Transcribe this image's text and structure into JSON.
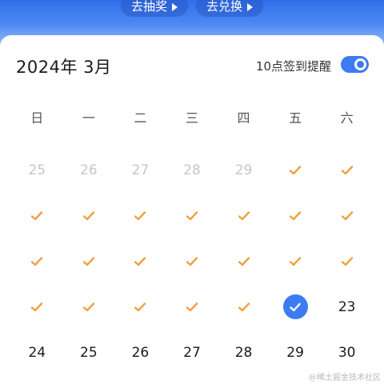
{
  "header": {
    "lottery_label": "去抽奖",
    "redeem_label": "去兑换"
  },
  "calendar": {
    "month_title": "2024年 3月",
    "reminder_label": "10点签到提醒",
    "reminder_enabled": true,
    "weekdays": [
      "日",
      "一",
      "二",
      "三",
      "四",
      "五",
      "六"
    ],
    "cells": [
      {
        "text": "25",
        "state": "other-month"
      },
      {
        "text": "26",
        "state": "other-month"
      },
      {
        "text": "27",
        "state": "other-month"
      },
      {
        "text": "28",
        "state": "other-month"
      },
      {
        "text": "29",
        "state": "other-month"
      },
      {
        "text": "",
        "state": "signed"
      },
      {
        "text": "",
        "state": "signed"
      },
      {
        "text": "",
        "state": "signed"
      },
      {
        "text": "",
        "state": "signed"
      },
      {
        "text": "",
        "state": "signed"
      },
      {
        "text": "",
        "state": "signed"
      },
      {
        "text": "",
        "state": "signed"
      },
      {
        "text": "",
        "state": "signed"
      },
      {
        "text": "",
        "state": "signed"
      },
      {
        "text": "",
        "state": "signed"
      },
      {
        "text": "",
        "state": "signed"
      },
      {
        "text": "",
        "state": "signed"
      },
      {
        "text": "",
        "state": "signed"
      },
      {
        "text": "",
        "state": "signed"
      },
      {
        "text": "",
        "state": "signed"
      },
      {
        "text": "",
        "state": "signed"
      },
      {
        "text": "",
        "state": "signed"
      },
      {
        "text": "",
        "state": "signed"
      },
      {
        "text": "",
        "state": "signed"
      },
      {
        "text": "",
        "state": "signed"
      },
      {
        "text": "",
        "state": "signed"
      },
      {
        "text": "",
        "state": "today-signed"
      },
      {
        "text": "23",
        "state": "day"
      },
      {
        "text": "24",
        "state": "day"
      },
      {
        "text": "25",
        "state": "day"
      },
      {
        "text": "26",
        "state": "day"
      },
      {
        "text": "27",
        "state": "day"
      },
      {
        "text": "28",
        "state": "day"
      },
      {
        "text": "29",
        "state": "day"
      },
      {
        "text": "30",
        "state": "day"
      }
    ]
  },
  "colors": {
    "accent": "#3d7cf0",
    "check": "#f0a040",
    "muted": "#c4c6cc"
  },
  "icons": {
    "signed": "check-icon",
    "today": "check-circle-icon",
    "pill_arrow": "play-triangle-icon"
  },
  "watermark": "@稀土掘金技术社区"
}
